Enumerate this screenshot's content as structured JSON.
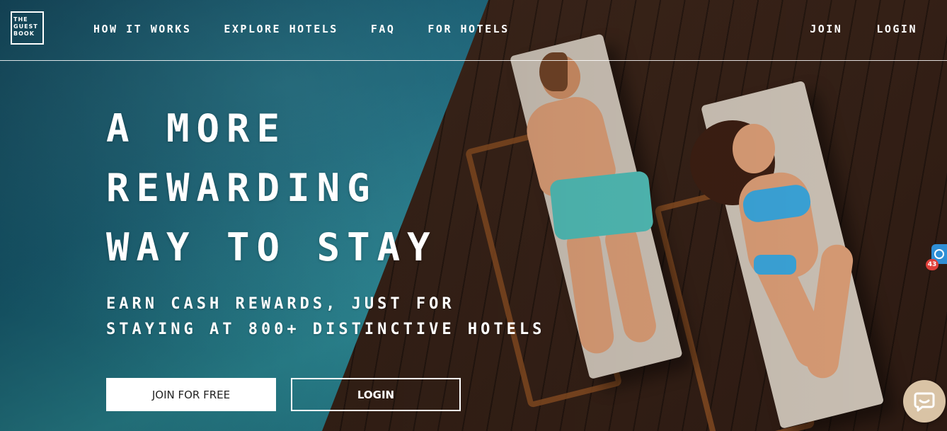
{
  "logo": {
    "lines": [
      "THE",
      "GUEST",
      "BOOK"
    ]
  },
  "nav": {
    "left": [
      {
        "label": "HOW IT WORKS"
      },
      {
        "label": "EXPLORE HOTELS"
      },
      {
        "label": "FAQ"
      },
      {
        "label": "FOR HOTELS"
      }
    ],
    "right": [
      {
        "label": "JOIN"
      },
      {
        "label": "LOGIN"
      }
    ]
  },
  "hero": {
    "title_lines": [
      "A MORE",
      "REWARDING",
      "WAY TO STAY"
    ],
    "subtitle_lines": [
      "EARN CASH REWARDS, JUST FOR",
      "STAYING AT 800+ DISTINCTIVE HOTELS"
    ],
    "join_button": "JOIN FOR FREE",
    "login_button": "LOGIN"
  },
  "widgets": {
    "notification_count": "43",
    "chat_icon": "chat-bubble-icon",
    "side_tab_icon": "magnifier-icon"
  },
  "colors": {
    "water": "#17627a",
    "deck": "#3a2419",
    "chat_button": "#d9c3a5",
    "badge": "#e0403a",
    "side_tab": "#2f8fd6"
  }
}
